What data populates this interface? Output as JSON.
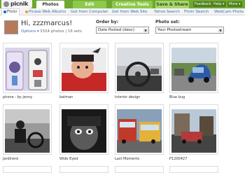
{
  "app": {
    "logo": "picnik"
  },
  "main_tabs": [
    {
      "label": "Photos",
      "active": true
    },
    {
      "label": "Edit"
    },
    {
      "label": "Creative Tools"
    },
    {
      "label": "Save & Share"
    }
  ],
  "top_buttons": [
    "Feedback",
    "Help ▾",
    "More ▾"
  ],
  "source_tabs": [
    {
      "label": "Flickr",
      "active": true
    },
    {
      "label": "Picasa Web Albums"
    },
    {
      "label": "Get from Computer"
    },
    {
      "label": "Get from Web Site"
    },
    {
      "label": "Yahoo Search"
    },
    {
      "label": "Flickr Search"
    },
    {
      "label": "WebCam Photo"
    }
  ],
  "user": {
    "greeting": "Hi, zzzmarcus!",
    "options": "Options ▾",
    "count": "3324 photos | 16 sets"
  },
  "filters": {
    "order_label": "Order by:",
    "order_value": "Date Posted (desc)",
    "set_label": "Photo set:",
    "set_value": "Your Photostream"
  },
  "photos": [
    {
      "caption": "phone - by jenny",
      "icon": "phone-sticker-photo"
    },
    {
      "caption": "batman",
      "icon": "child-batman-photo"
    },
    {
      "caption": "interior design",
      "icon": "car-interior-photo"
    },
    {
      "caption": "Blue bug",
      "icon": "blue-bug-car-photo"
    },
    {
      "caption": "Jardinero",
      "icon": "gardener-photo"
    },
    {
      "caption": "Wide Eyed",
      "icon": "wide-eyed-child-photo"
    },
    {
      "caption": "Last Moments",
      "icon": "buses-photo"
    },
    {
      "caption": "P1200427",
      "icon": "street-photo"
    }
  ],
  "colors": {
    "brand_green": "#6fa82f",
    "link_blue": "#3a6fb0"
  }
}
